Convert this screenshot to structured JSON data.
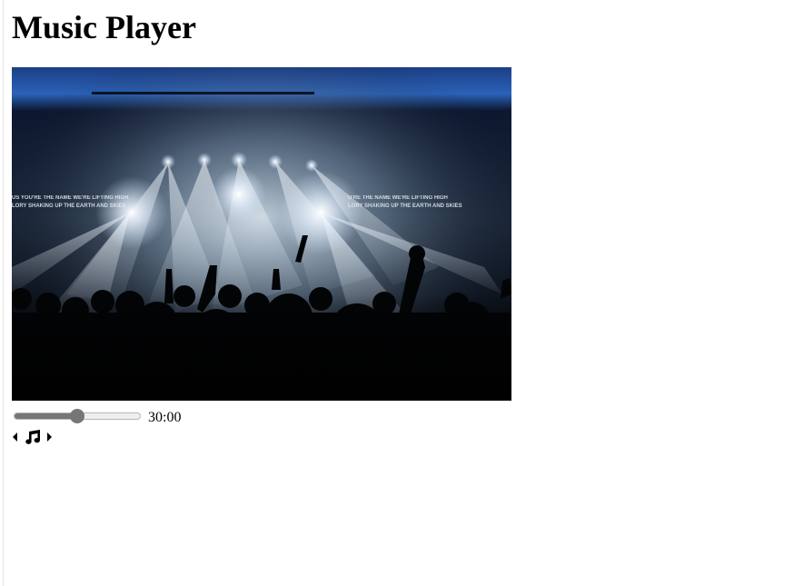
{
  "page": {
    "title": "Music Player"
  },
  "player": {
    "time_display": "30:00",
    "progress": 0.5,
    "cover": {
      "banner_text_left_1": "US YOU'RE THE NAME WE'RE LIFTING HIGH",
      "banner_text_left_2": "LORY SHAKING UP THE EARTH AND SKIES",
      "banner_text_right_1": "U'RE THE NAME WE'RE LIFTING HIGH",
      "banner_text_right_2": "LORY SHAKING UP THE EARTH AND SKIES"
    },
    "controls": {
      "prev_icon": "caret-left-icon",
      "play_icon": "music-note-icon",
      "next_icon": "caret-right-icon"
    }
  },
  "colors": {
    "slider_accent": "#767676",
    "slider_track": "#efefef"
  }
}
